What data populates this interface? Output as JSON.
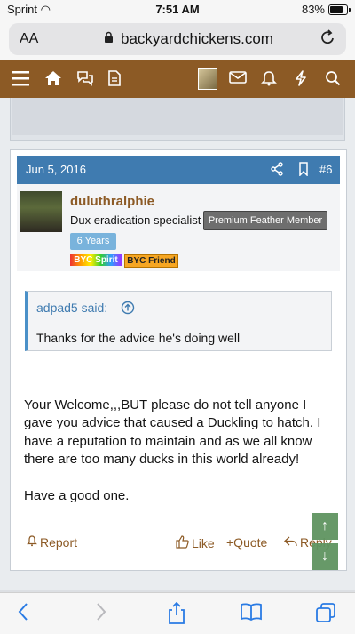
{
  "status_bar": {
    "carrier": "Sprint",
    "time": "7:51 AM",
    "battery": "83%"
  },
  "browser": {
    "text_size_label": "AA",
    "domain": "backyardchickens.com"
  },
  "nav": {
    "icons": [
      "menu-icon",
      "home-icon",
      "forums-icon",
      "articles-icon",
      "avatar",
      "inbox-icon",
      "alerts-icon",
      "whats-new-icon",
      "search-icon"
    ],
    "color": "#8c5a25"
  },
  "post": {
    "date": "Jun 5, 2016",
    "number": "#6",
    "header_color": "#3f7bb0",
    "username": "duluthralphie",
    "user_title": "Dux eradication specialist",
    "member_badge": "Premium Feather Member",
    "years_badge": "6 Years",
    "badge_spirit": "BYC Spirit",
    "badge_friend": "BYC Friend",
    "quote": {
      "author": "adpad5 said:",
      "text": "Thanks for the advice he's doing well"
    },
    "message": [
      "Your Welcome,,,BUT please do not tell anyone I gave you advice that caused a Duckling to hatch. I have a reputation to maintain and as we all know there are too many ducks in this world already!",
      "Have a good one."
    ],
    "actions": {
      "report": "Report",
      "like": "Like",
      "quote": "+Quote",
      "reply": "Reply"
    }
  },
  "scroll": {
    "up": "↑",
    "down": "↓"
  },
  "bottom_bar": [
    "back-icon",
    "forward-icon",
    "share-icon",
    "bookmarks-icon",
    "tabs-icon"
  ]
}
